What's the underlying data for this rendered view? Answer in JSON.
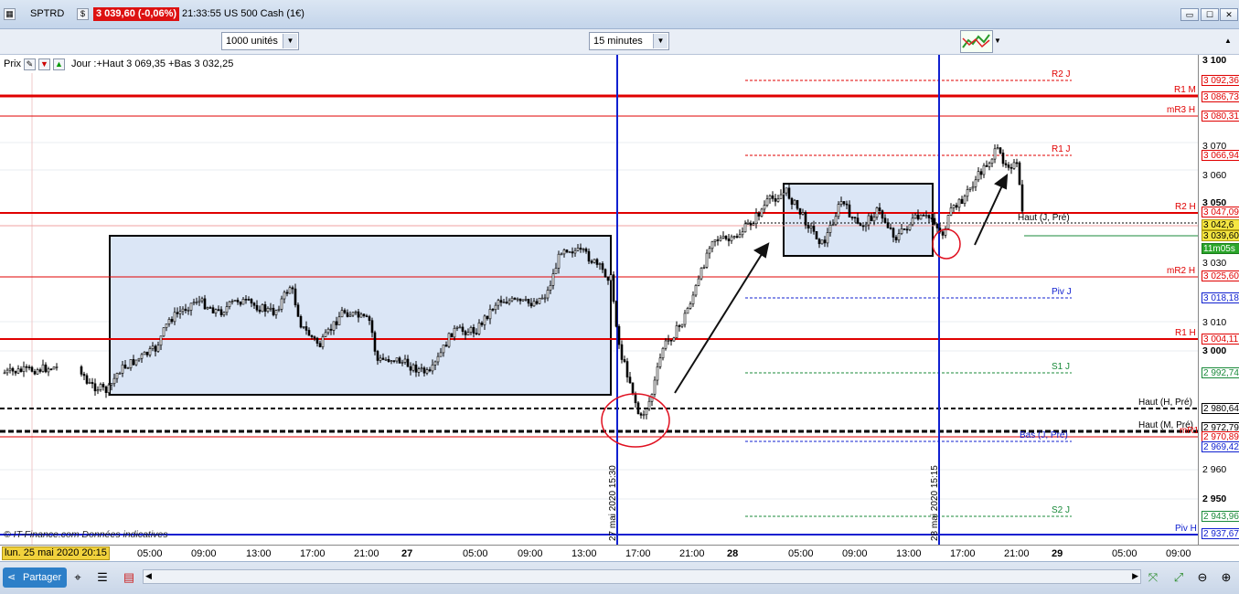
{
  "titlebar": {
    "symbol": "SPTRD",
    "price_change": "3 039,60 (-0,06%)",
    "time_name": "21:33:55 US 500 Cash (1€)",
    "icon_label": "$"
  },
  "toolbar": {
    "units": "1000 unités",
    "interval": "15 minutes"
  },
  "plot": {
    "price_label": "Prix",
    "day_info": "Jour :+Haut 3 069,35 +Bas 3 032,25",
    "copyright": "© IT-Finance.com  Données indicatives",
    "vline_label_1": "27 mai 2020 15:30",
    "vline_label_2": "28 mai 2020 15:15"
  },
  "levels": {
    "r2j": "R2 J",
    "r1m": "R1 M",
    "mr3h": "mR3 H",
    "r1j": "R1 J",
    "r2h": "R2 H",
    "haut_j_pre": "Haut (J, Pré)",
    "mr2h": "mR2 H",
    "pivj": "Piv J",
    "r1h": "R1 H",
    "s1j": "S1 J",
    "haut_h_pre": "Haut (H, Pré)",
    "haut_m_pre": "Haut (M, Pré)",
    "bas_j_pre": "Bas (J, Pré)",
    "mr1": "mR1",
    "s2j": "S2 J",
    "pivh": "Piv H"
  },
  "yaxis": {
    "ticks": [
      "3 100",
      "3 070",
      "3 060",
      "3 050",
      "3 030",
      "3 010",
      "3 000",
      "2 960",
      "2 950"
    ],
    "boxes": [
      "3 092,36",
      "3 086,73",
      "3 080,31",
      "3 066,94",
      "3 047,09",
      "3 042,6",
      "3 039,60",
      "11m05s",
      "3 025,60",
      "3 018,18",
      "3 004,11",
      "2 992,74",
      "2 980,64",
      "2 972,79",
      "2 970,89",
      "2 969,42",
      "2 943,96",
      "2 937,67"
    ]
  },
  "xaxis": {
    "current_date": "lun. 25 mai 2020 20:15",
    "ticks": [
      "05:00",
      "09:00",
      "13:00",
      "17:00",
      "21:00",
      "27",
      "05:00",
      "09:00",
      "13:00",
      "17:00",
      "21:00",
      "28",
      "05:00",
      "09:00",
      "13:00",
      "17:00",
      "21:00",
      "29",
      "05:00",
      "09:00"
    ]
  },
  "bottom": {
    "share_label": "Partager"
  },
  "colors": {
    "resistance": "#e00000",
    "blue_line": "#1020d0",
    "support": "#1a8a3a",
    "box_fill": "#dbe6f6"
  }
}
